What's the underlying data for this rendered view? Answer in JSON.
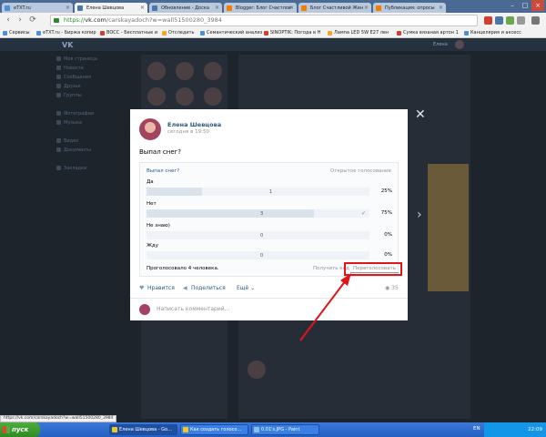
{
  "browser": {
    "tabs": [
      {
        "label": "eTXT.ru",
        "color": "#4b8fd8"
      },
      {
        "label": "Елена Шевцова",
        "color": "#4a76a8"
      },
      {
        "label": "Обновление - Доска",
        "color": "#4a76a8"
      },
      {
        "label": "Blogger: Блог Счастлов",
        "color": "#f57d00"
      },
      {
        "label": "Блог Счастливой Жен",
        "color": "#f57d00"
      },
      {
        "label": "Публикация: опросы",
        "color": "#f57d00"
      }
    ],
    "url": {
      "scheme": "https://",
      "host": "vk.com",
      "path": "/carskayadoch?w=wall51500280_3984"
    },
    "bookmarks": [
      {
        "label": "Сервисы",
        "color": "#4b8fd8"
      },
      {
        "label": "eTXT.ru - Биржа копир",
        "color": "#4b8fd8"
      },
      {
        "label": "BOCC - Бесплатные и",
        "color": "#d23f31"
      },
      {
        "label": "Отследить",
        "color": "#f5a623"
      },
      {
        "label": "Семантический анализ",
        "color": "#4b8fd8"
      },
      {
        "label": "SINOPTIK: Погода в Н",
        "color": "#d23f31"
      },
      {
        "label": "Лампа LED 5W E27 лен",
        "color": "#f5a623"
      },
      {
        "label": "Сумка вязаная артон 1",
        "color": "#d23f31"
      },
      {
        "label": "Канцелярия и аксесс",
        "color": "#4b8fd8"
      }
    ]
  },
  "vk": {
    "logo": "VK",
    "user_name": "Елена",
    "left_menu": [
      "Моя страница",
      "Новости",
      "Сообщения",
      "Друзья",
      "Группы",
      "Фотографии",
      "Музыка",
      "Видео",
      "Документы",
      "Закладки"
    ]
  },
  "post": {
    "author": "Елена Шевцова",
    "time": "сегодня в 19:50",
    "text": "Выпал снег?",
    "poll": {
      "title": "Выпал снег?",
      "type": "Открытое голосование",
      "options": [
        {
          "label": "Да",
          "count": "1",
          "percent": "25%",
          "fraction": 0.25,
          "chosen": false
        },
        {
          "label": "Нет",
          "count": "3",
          "percent": "75%",
          "fraction": 0.75,
          "chosen": true
        },
        {
          "label": "Не знаю)",
          "count": "0",
          "percent": "0%",
          "fraction": 0,
          "chosen": false
        },
        {
          "label": "Жду",
          "count": "0",
          "percent": "0%",
          "fraction": 0,
          "chosen": false
        }
      ],
      "voted": "Проголосовало 4 человека.",
      "get_code": "Получить код",
      "revote": "Переголосовать"
    },
    "actions": {
      "like": "Нравится",
      "share": "Поделиться",
      "more": "Ещё"
    },
    "views": "35",
    "comment_placeholder": "Написать комментарий..."
  },
  "status_url": "https://vk.com/carskayadoch?w=wall51500280_3984",
  "taskbar": {
    "start": "пуск",
    "tasks": [
      "Елена Шевцова - Go...",
      "Как создать голосо...",
      "0.01's.JPG - Paint"
    ],
    "lang": "EN",
    "time": "22:09"
  },
  "colors": {
    "accent": "#2a5885",
    "highlight": "#e1151a",
    "arrow": "#e1151a"
  }
}
